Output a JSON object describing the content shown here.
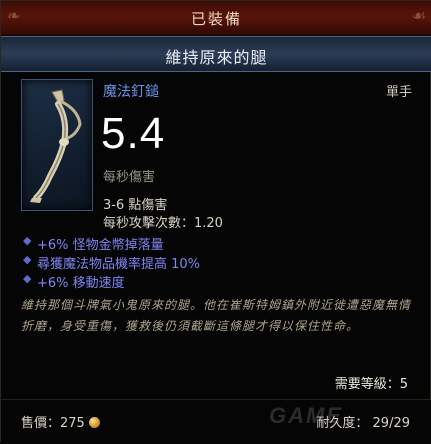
{
  "header": {
    "equipped_label": "已裝備"
  },
  "item": {
    "name": "維持原來的腿",
    "type": "魔法釘鎚",
    "hand": "單手",
    "dps": "5.4",
    "dps_label": "每秒傷害",
    "damage": "3-6 點傷害",
    "attacks_per_second": "每秒攻擊次數：1.20",
    "affixes": [
      "+6% 怪物金幣掉落量",
      "尋獲魔法物品機率提高 10%",
      "+6% 移動速度"
    ],
    "flavor": "維持那個斗牌氣小鬼原來的腿。他在崔斯特姆鎮外附近徙遭惡魔無情折磨，身受重傷，獲救後仍須截斷這條腿才得以保住性命。",
    "required_level": "需要等級：5"
  },
  "footer": {
    "price": "售價：275",
    "durability": "耐久度：  29/29",
    "watermark": "GAME"
  }
}
